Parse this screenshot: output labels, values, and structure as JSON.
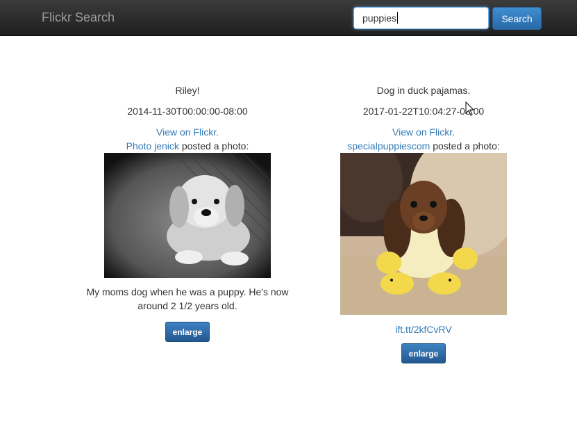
{
  "navbar": {
    "brand": "Flickr Search",
    "search_value": "puppies",
    "search_button": "Search"
  },
  "results": [
    {
      "title": "Riley!",
      "date": "2014-11-30T00:00:00-08:00",
      "view_link": "View on Flickr.",
      "author": "Photo jenick",
      "posted_text": "posted a photo:",
      "description": "My moms dog when he was a puppy. He's now around 2 1/2 years old.",
      "enlarge": "enlarge"
    },
    {
      "title": "Dog in duck pajamas.",
      "date": "2017-01-22T10:04:27-08:00",
      "view_link": "View on Flickr.",
      "author": "specialpuppiescom",
      "posted_text": "posted a photo:",
      "shortlink": "ift.tt/2kfCvRV",
      "enlarge": "enlarge"
    }
  ],
  "colors": {
    "link": "#337ab7",
    "navbar": "#222222",
    "button": "#2e6da4"
  }
}
